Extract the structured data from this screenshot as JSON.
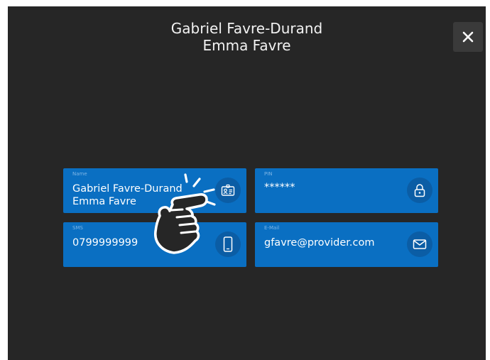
{
  "header": {
    "title_line1": "Gabriel Favre-Durand",
    "title_line2": "Emma Favre"
  },
  "close_button": {
    "label": "✕",
    "icon": "close-icon"
  },
  "cards": {
    "name": {
      "label": "Name",
      "value_line1": "Gabriel Favre-Durand",
      "value_line2": "Emma Favre",
      "icon": "id-card-icon"
    },
    "pin": {
      "label": "PIN",
      "value": "******",
      "icon": "lock-icon"
    },
    "sms": {
      "label": "SMS",
      "value": "0799999999",
      "icon": "mobile-phone-icon"
    },
    "email": {
      "label": "E-Mail",
      "value": "gfavre@provider.com",
      "icon": "envelope-icon"
    }
  },
  "overlay": {
    "icon": "tap-gesture-hand-icon"
  },
  "colors": {
    "background": "#262626",
    "card": "#0a6fc2",
    "icon_circle": "#0b5da5",
    "close_button": "#3a3a3a"
  }
}
